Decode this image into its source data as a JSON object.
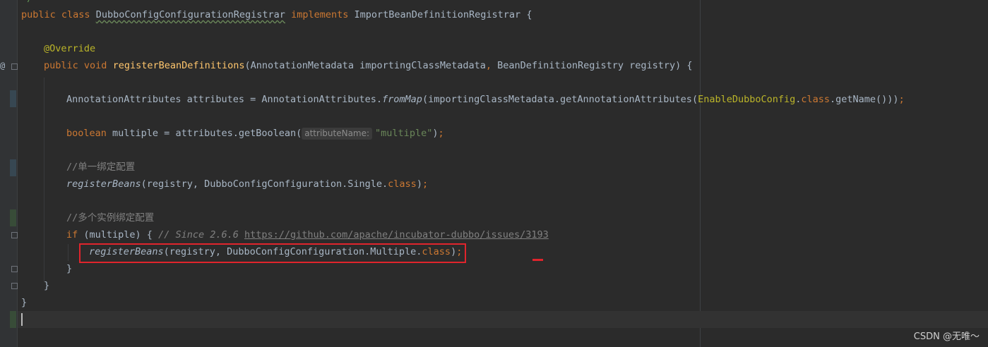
{
  "editor": {
    "partial_comment": "*/",
    "lines": {
      "class_decl": {
        "public": "public",
        "class": "class",
        "class_name": "DubboConfigConfigurationRegistrar",
        "implements": "implements",
        "interface": "ImportBeanDefinitionRegistrar",
        "brace": " {"
      },
      "override": "@Override",
      "method_decl": {
        "public": "public",
        "void": "void",
        "name": "registerBeanDefinitions",
        "params_a": "(AnnotationMetadata importingClassMetadata",
        "comma": ",",
        "params_b": " BeanDefinitionRegistry registry) {"
      },
      "attrs_line": {
        "a": "AnnotationAttributes attributes = AnnotationAttributes.",
        "from_map": "fromMap",
        "b": "(importingClassMetadata.getAnnotationAttributes(",
        "enable": "EnableDubboConfig",
        "dot": ".",
        "class_kw": "class",
        "c": ".getName()))",
        "semi": ";"
      },
      "bool_line": {
        "kw": "boolean",
        "a": " multiple = attributes.getBoolean(",
        "hint": "attributeName:",
        "str": "\"multiple\"",
        "b": ")",
        "semi": ";"
      },
      "comment_single": "//单一绑定配置",
      "register_single": {
        "name": "registerBeans",
        "a": "(registry, DubboConfigConfiguration.Single.",
        "class_kw": "class",
        "b": ")",
        "semi": ";"
      },
      "comment_multi": "//多个实例绑定配置",
      "if_line": {
        "if_kw": "if",
        "a": " (multiple) { ",
        "cmt": "// Since 2.6.6 ",
        "url": "https://github.com/apache/incubator-dubbo/issues/3193"
      },
      "register_multi": {
        "name": "registerBeans",
        "a": "(registry, DubboConfigConfiguration.Multiple.",
        "class_kw": "class",
        "b": ")",
        "semi": ";"
      },
      "close_if": "}",
      "close_method": "}",
      "close_class": "}"
    }
  },
  "watermark": "CSDN @无唯～",
  "colors": {
    "background": "#2b2b2b",
    "keyword": "#cc7832",
    "method": "#ffc66d",
    "annotation": "#bbb529",
    "string": "#6a8759",
    "comment": "#808080",
    "highlight": "#e0242c"
  }
}
